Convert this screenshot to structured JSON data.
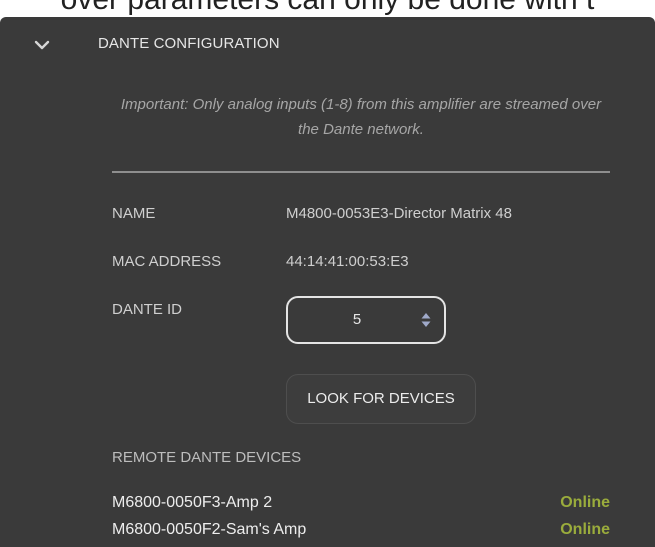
{
  "top_fragment": "over parameters can only be done with t",
  "section": {
    "title": "DANTE CONFIGURATION",
    "chevron_icon": "chevron-down-icon",
    "note": "Important: Only analog inputs (1-8) from this amplifier are streamed over the Dante network."
  },
  "fields": {
    "name_label": "NAME",
    "name_value": "M4800-0053E3-Director Matrix 48",
    "mac_label": "MAC ADDRESS",
    "mac_value": "44:14:41:00:53:E3",
    "dante_id_label": "DANTE ID",
    "dante_id_value": "5",
    "spin_icon": "updown-arrows-icon"
  },
  "actions": {
    "look_for_devices": "LOOK FOR DEVICES"
  },
  "remote": {
    "label": "REMOTE DANTE DEVICES",
    "devices": [
      {
        "name": "M6800-0050F3-Amp 2",
        "status": "Online"
      },
      {
        "name": "M6800-0050F2-Sam's Amp",
        "status": "Online"
      }
    ]
  },
  "colors": {
    "panel_background": "#3a3a3a",
    "online_status": "#9aac3c",
    "divider": "#8e8e8e"
  }
}
